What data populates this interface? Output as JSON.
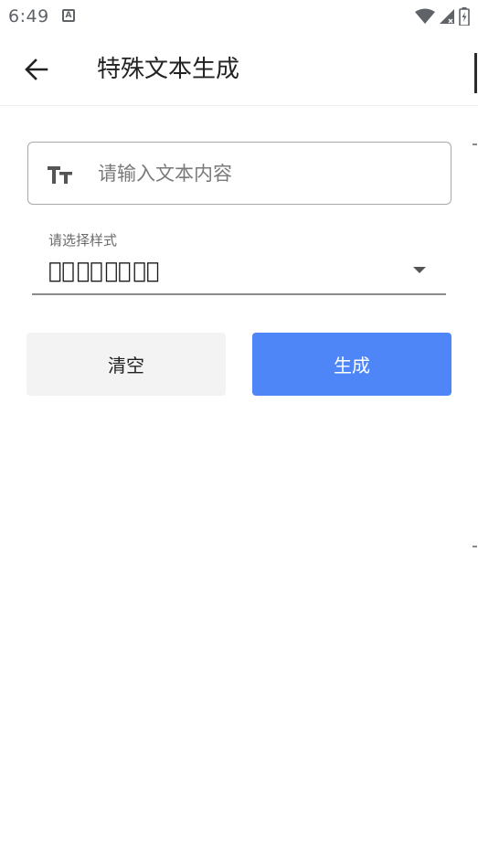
{
  "status_bar": {
    "time": "6:49",
    "notification_icon": "accessibility-A-icon",
    "icons": [
      "wifi-icon",
      "cellular-signal-icon",
      "battery-charging-icon"
    ]
  },
  "app_bar": {
    "back_icon": "arrow-back-icon",
    "title": "特殊文本生成"
  },
  "text_input": {
    "icon": "text-size-icon",
    "placeholder": "请输入文本内容",
    "value": ""
  },
  "style_select": {
    "label": "请选择样式",
    "selected_value": "测⃠试⃠测⃠试⃠",
    "icon": "dropdown-arrow-icon"
  },
  "buttons": {
    "clear_label": "清空",
    "generate_label": "生成"
  },
  "colors": {
    "primary": "#4f86f7",
    "clear_bg": "#f3f3f3",
    "outline": "#a9a9a9"
  }
}
